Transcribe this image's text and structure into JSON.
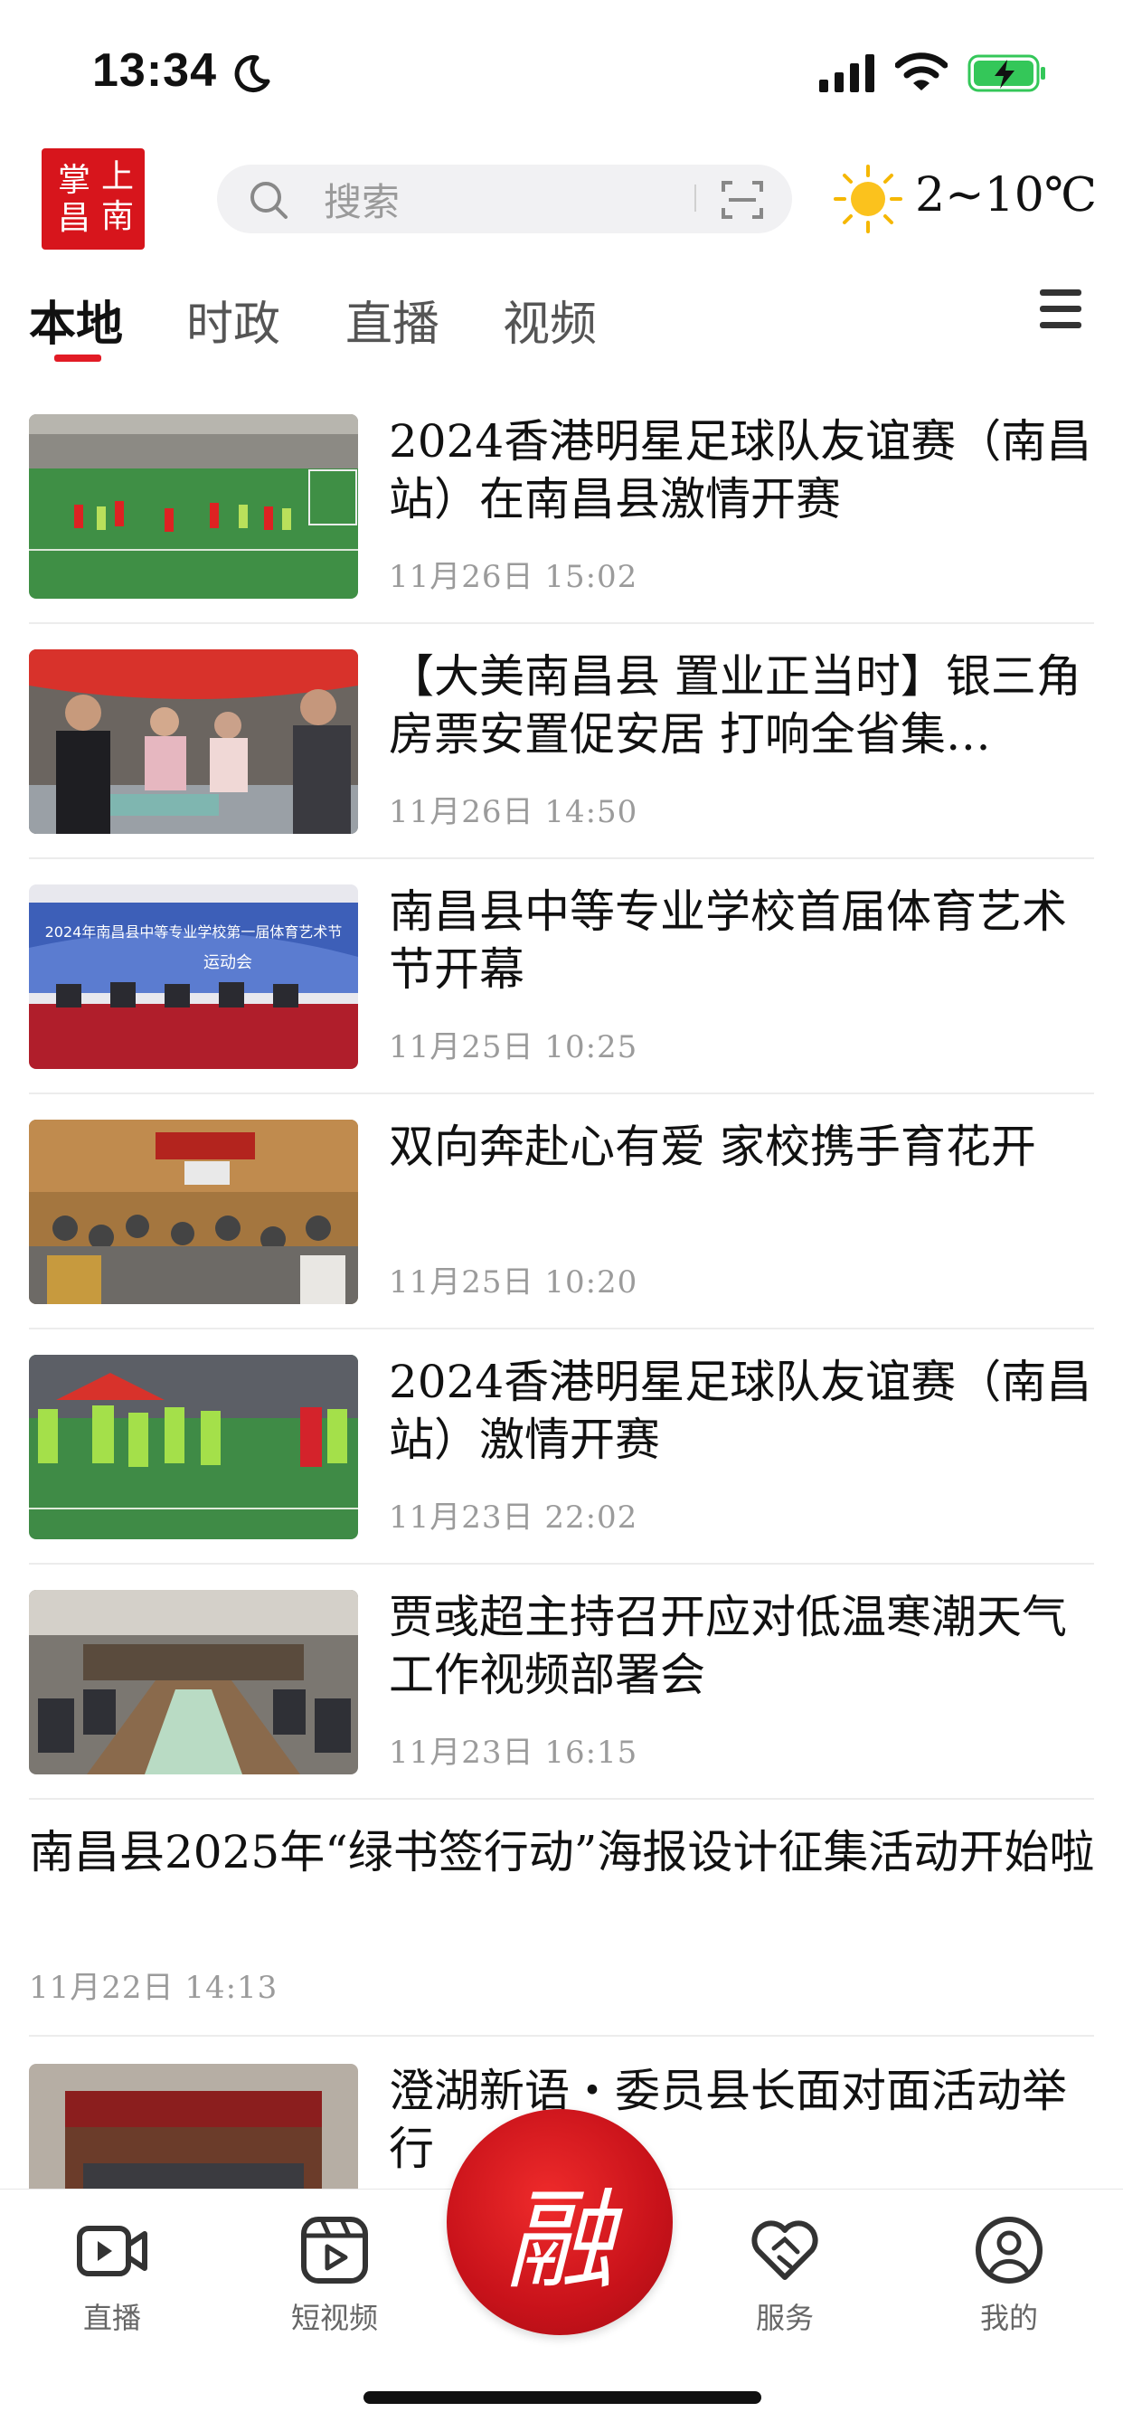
{
  "status_bar": {
    "time": "13:34",
    "icons": [
      "moon-icon",
      "signal-icon",
      "wifi-icon",
      "battery-charging-icon"
    ],
    "battery_color": "#34c759"
  },
  "header": {
    "logo_chars": [
      "掌",
      "上",
      "昌",
      "南"
    ],
    "logo_color": "#d7151c",
    "search_placeholder": "搜索",
    "weather_icon": "sun-icon",
    "weather_text": "2~10℃"
  },
  "tabs": [
    {
      "label": "本地",
      "active": true
    },
    {
      "label": "时政",
      "active": false
    },
    {
      "label": "直播",
      "active": false
    },
    {
      "label": "视频",
      "active": false
    }
  ],
  "accent_color": "#e21b25",
  "news": [
    {
      "title": "2024香港明星足球队友谊赛（南昌站）在南昌县激情开赛",
      "date": "11月26日  15:02",
      "thumb": "soccer-match-photo"
    },
    {
      "title": "【大美南昌县  置业正当时】银三角房票安置促安居  打响全省集…",
      "date": "11月26日  14:50",
      "thumb": "housing-event-photo"
    },
    {
      "title": "南昌县中等专业学校首届体育艺术节开幕",
      "date": "11月25日  10:25",
      "thumb": "school-festival-photo",
      "banner_text": "2024年南昌县中等专业学校第一届体育艺术节",
      "banner_sub": "运动会"
    },
    {
      "title": "双向奔赴心有爱    家校携手育花开",
      "date": "11月25日  10:20",
      "thumb": "parent-meeting-photo"
    },
    {
      "title": "2024香港明星足球队友谊赛（南昌站）激情开赛",
      "date": "11月23日  22:02",
      "thumb": "soccer-players-photo"
    },
    {
      "title": "贾彧超主持召开应对低温寒潮天气工作视频部署会",
      "date": "11月23日  16:15",
      "thumb": "conference-room-photo"
    },
    {
      "title": "南昌县2025年“绿书签行动”海报设计征集活动开始啦",
      "date": "11月22日  14:13"
    },
    {
      "title": "澄湖新语・委员县长面对面活动举行",
      "thumb": "auditorium-photo"
    }
  ],
  "bottom_tabs": [
    {
      "label": "直播",
      "icon": "live-video-icon"
    },
    {
      "label": "短视频",
      "icon": "short-video-icon"
    },
    {
      "label": "融",
      "icon": "fusion-center-button"
    },
    {
      "label": "服务",
      "icon": "handshake-heart-icon"
    },
    {
      "label": "我的",
      "icon": "user-profile-icon"
    }
  ]
}
